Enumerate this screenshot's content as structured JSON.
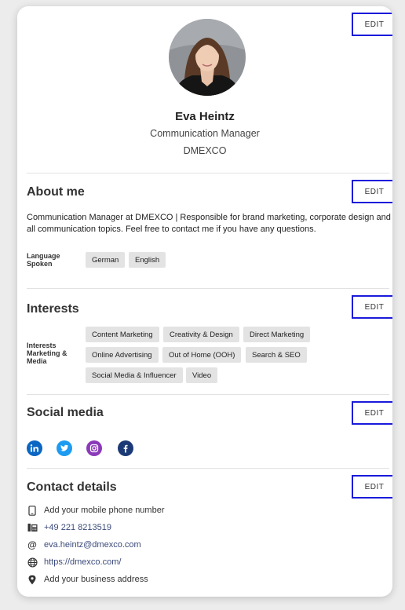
{
  "profile": {
    "name": "Eva Heintz",
    "role": "Communication Manager",
    "company": "DMEXCO",
    "edit_label": "EDIT"
  },
  "about": {
    "title": "About me",
    "edit_label": "EDIT",
    "text": "Communication Manager at DMEXCO | Responsible for brand marketing, corporate design and all communication topics. Feel free to contact me if you have any questions.",
    "language_label_line1": "Language",
    "language_label_line2": "Spoken",
    "languages": [
      "German",
      "English"
    ]
  },
  "interests": {
    "title": "Interests",
    "edit_label": "EDIT",
    "label_line1": "Interests",
    "label_line2": "Marketing &",
    "label_line3": "Media",
    "tags": [
      "Content Marketing",
      "Creativity & Design",
      "Direct Marketing",
      "Online Advertising",
      "Out of Home (OOH)",
      "Search & SEO",
      "Social Media & Influencer",
      "Video"
    ]
  },
  "social": {
    "title": "Social media",
    "edit_label": "EDIT",
    "icons": [
      "linkedin-icon",
      "twitter-icon",
      "instagram-icon",
      "facebook-icon"
    ],
    "colors": {
      "linkedin": "#0a66c2",
      "twitter": "#1d9bf0",
      "instagram": "#8a3ab9",
      "facebook": "#1b3a75"
    }
  },
  "contact": {
    "title": "Contact details",
    "edit_label": "EDIT",
    "mobile": "Add your mobile phone number",
    "phone": "+49 221 8213519",
    "email": "eva.heintz@dmexco.com",
    "website": "https://dmexco.com/",
    "address": "Add your business address"
  },
  "colors": {
    "edit_border": "#1a1adb",
    "link": "#3b4a7a"
  }
}
